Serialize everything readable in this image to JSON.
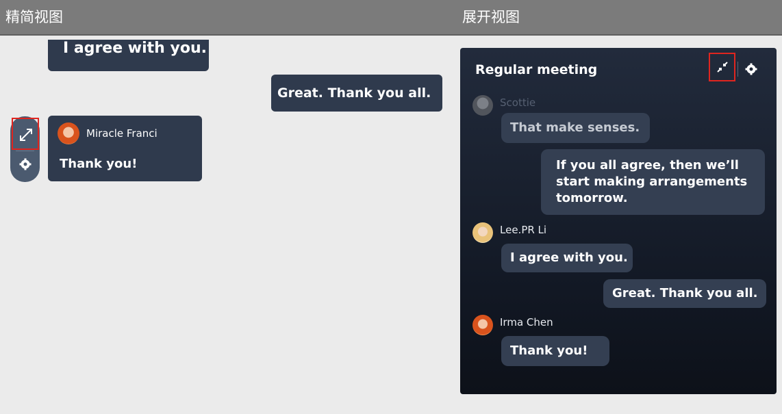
{
  "headers": {
    "compact": "精简视图",
    "expanded": "展开视图"
  },
  "compact": {
    "messages": {
      "partial_message": "I agree with you.",
      "outgoing_message": "Great. Thank you all."
    },
    "card": {
      "sender": "Miracle Franci",
      "text": "Thank you!"
    },
    "controls": {
      "expand_icon": "expand-arrows-icon",
      "settings_icon": "gear-icon"
    }
  },
  "expanded": {
    "title": "Regular meeting",
    "controls": {
      "collapse_icon": "collapse-arrows-icon",
      "settings_icon": "gear-icon"
    },
    "messages": [
      {
        "sender": "Scottie",
        "text": "That make senses."
      },
      {
        "sender": "",
        "text": "If you all agree, then we’ll start making arrangements tomorrow."
      },
      {
        "sender": "Lee.PR Li",
        "text": "I agree with you."
      },
      {
        "sender": "",
        "text": "Great. Thank you all."
      },
      {
        "sender": "Irma Chen",
        "text": "Thank you!"
      }
    ]
  },
  "colors": {
    "header_bg": "#7b7b7b",
    "bubble": "#2f3a4d",
    "highlight": "#e0251f"
  }
}
